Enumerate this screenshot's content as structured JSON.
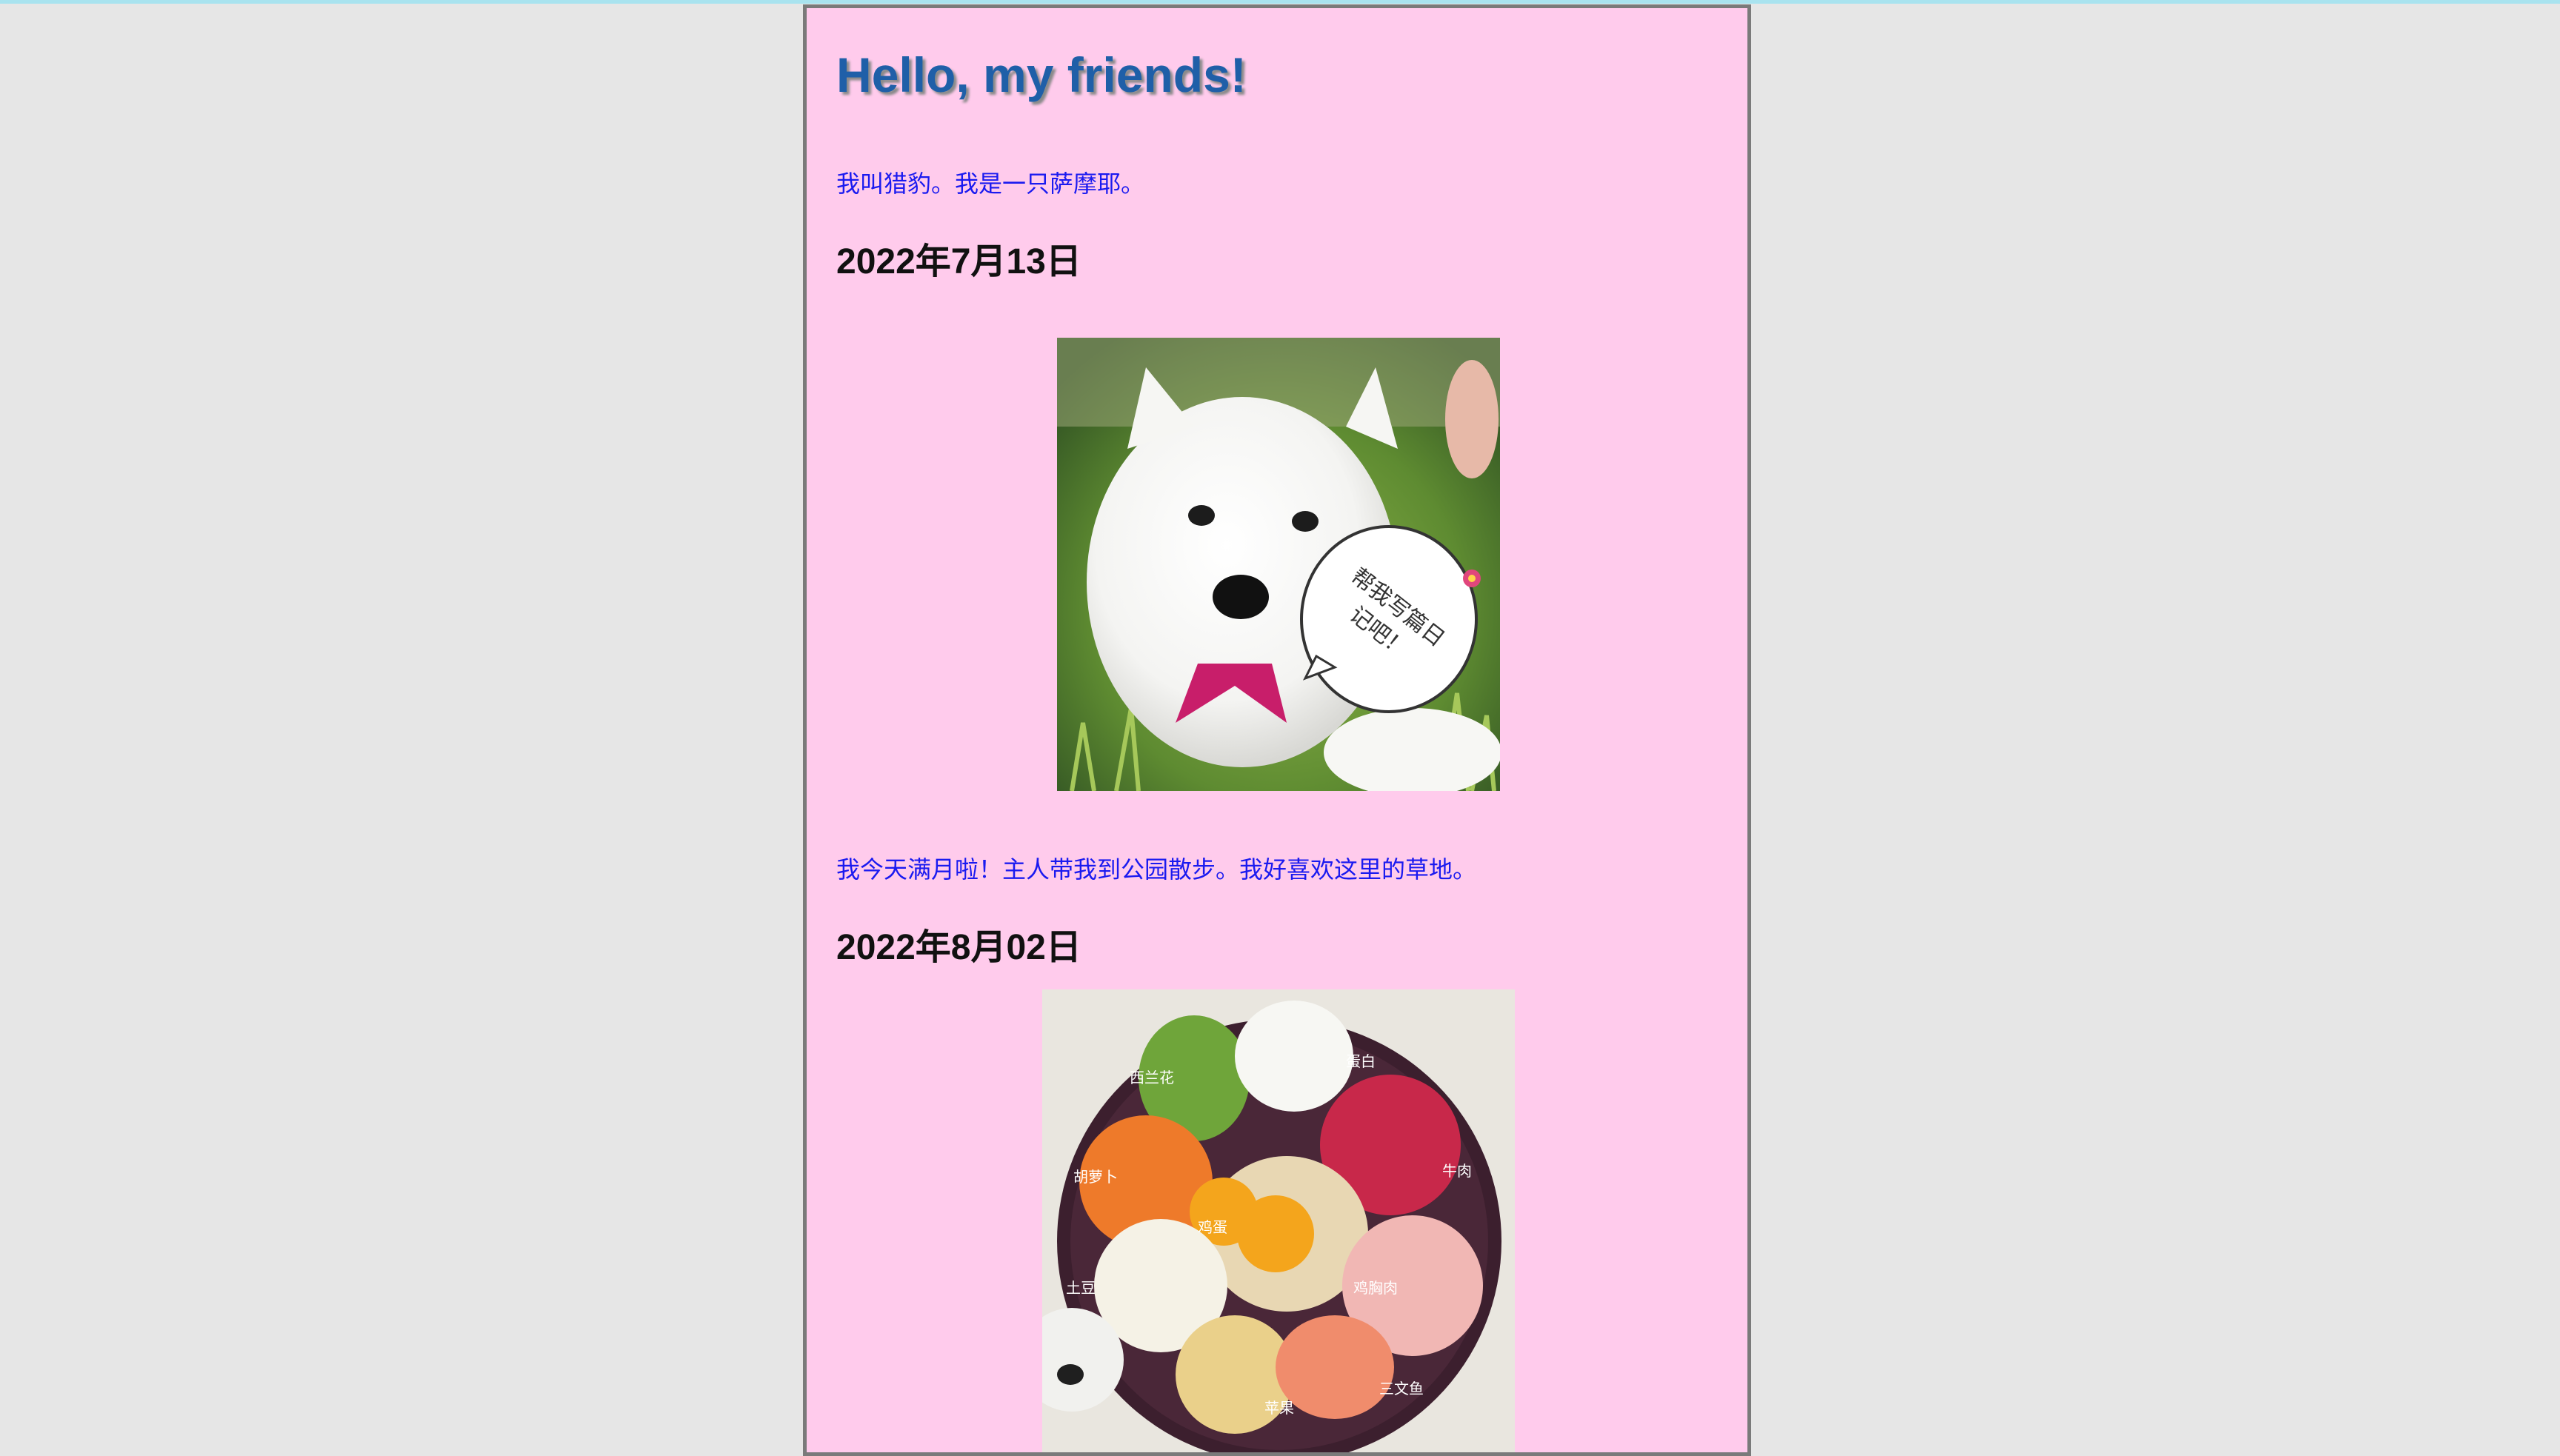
{
  "page": {
    "title": "Hello, my friends!",
    "intro": "我叫猎豹。我是一只萨摩耶。"
  },
  "entries": [
    {
      "date": "2022年7月13日",
      "image_bubble_lines": [
        "帮我写篇日",
        "记吧！"
      ],
      "caption": "我今天满月啦！主人带我到公园散步。我好喜欢这里的草地。"
    },
    {
      "date": "2022年8月02日",
      "image_labels": [
        "西兰花",
        "蛋白",
        "牛肉",
        "胡萝卜",
        "鸡蛋",
        "鸡胸肉",
        "土豆",
        "苹果",
        "三文鱼"
      ]
    }
  ],
  "colors": {
    "background": "#e6e6e6",
    "card": "#ffcbec",
    "title": "#1f5fa8",
    "body_text": "#1a1af0"
  }
}
